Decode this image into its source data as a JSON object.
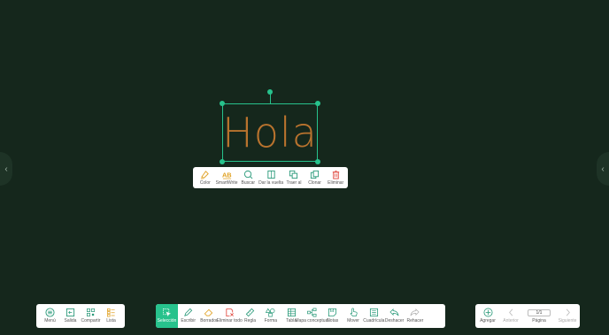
{
  "canvas": {
    "background": "#15271c",
    "text": "Hola",
    "stroke_color": "#b9732e",
    "selection_color": "#27c28c"
  },
  "edge": {
    "left_glyph": "‹",
    "right_glyph": "‹"
  },
  "context_menu": {
    "items": [
      {
        "label": "Color",
        "icon": "palette-icon"
      },
      {
        "label": "SmartWrite",
        "icon": "smartwrite-icon"
      },
      {
        "label": "Buscar",
        "icon": "search-icon"
      },
      {
        "label": "Dar la vuelta",
        "icon": "flip-icon"
      },
      {
        "label": "Traer al",
        "icon": "bring-front-icon"
      },
      {
        "label": "Clonar",
        "icon": "clone-icon"
      },
      {
        "label": "Eliminar",
        "icon": "trash-icon"
      }
    ]
  },
  "left_toolbar": {
    "items": [
      {
        "label": "Menú",
        "icon": "menu-icon"
      },
      {
        "label": "Salida",
        "icon": "exit-icon"
      },
      {
        "label": "Compartir",
        "icon": "qr-icon"
      },
      {
        "label": "Lista",
        "icon": "list-icon"
      }
    ]
  },
  "main_toolbar": {
    "items": [
      {
        "label": "Selección",
        "icon": "select-icon"
      },
      {
        "label": "Escribir",
        "icon": "pen-icon"
      },
      {
        "label": "Borrador",
        "icon": "eraser-icon"
      },
      {
        "label": "Eliminar todo",
        "icon": "clear-all-icon"
      },
      {
        "label": "Regla",
        "icon": "ruler-icon"
      },
      {
        "label": "Forma",
        "icon": "shape-icon"
      },
      {
        "label": "Tabla",
        "icon": "table-icon"
      },
      {
        "label": "Mapa conceptual",
        "icon": "mindmap-icon"
      },
      {
        "label": "Notas",
        "icon": "notes-icon"
      },
      {
        "label": "Mover",
        "icon": "hand-icon"
      },
      {
        "label": "Cuadrícula",
        "icon": "grid-icon"
      },
      {
        "label": "Deshacer",
        "icon": "undo-icon"
      },
      {
        "label": "Rehacer",
        "icon": "redo-icon"
      }
    ]
  },
  "right_toolbar": {
    "add_label": "Agregar",
    "prev_label": "Anterior",
    "page_label": "Página",
    "page_value": "1/1",
    "next_label": "Siguiente"
  }
}
